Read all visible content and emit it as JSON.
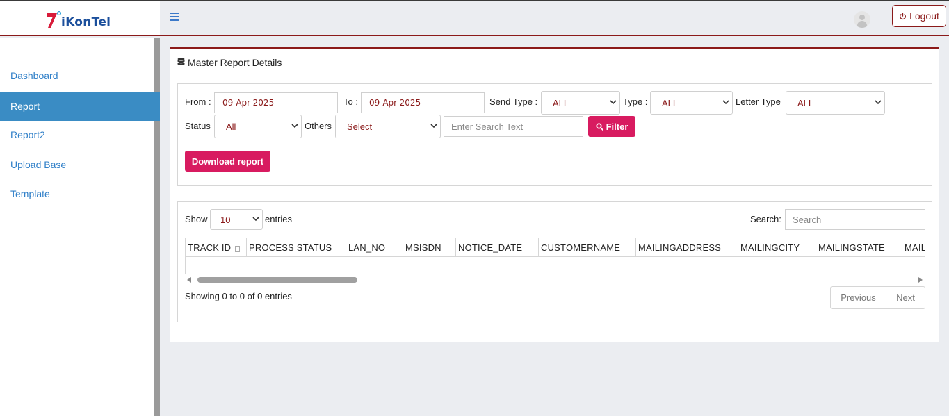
{
  "brand": {
    "logo_text": "iKonTel",
    "colors": {
      "red": "#d81b3a",
      "blue": "#1b4f9c"
    }
  },
  "header": {
    "menu_icon": "hamburger-icon",
    "avatar_icon": "user-avatar-icon",
    "logout_label": "Logout",
    "logout_icon": "power-icon"
  },
  "sidebar": {
    "items": [
      {
        "label": "Dashboard",
        "active": false
      },
      {
        "label": "Report",
        "active": true
      },
      {
        "label": "Report2",
        "active": false
      },
      {
        "label": "Upload Base",
        "active": false
      },
      {
        "label": "Template",
        "active": false
      }
    ]
  },
  "card": {
    "title": "Master Report Details",
    "title_icon": "database-icon"
  },
  "filters": {
    "from_label": "From :",
    "from_value": "09-Apr-2025",
    "to_label": "To :",
    "to_value": "09-Apr-2025",
    "send_type_label": "Send Type :",
    "send_type_value": "ALL",
    "type_label": "Type :",
    "type_value": "ALL",
    "letter_type_label": "Letter Type",
    "letter_type_value": "ALL",
    "status_label": "Status",
    "status_value": "All",
    "others_label": "Others",
    "others_value": "Select",
    "search_placeholder": "Enter Search Text",
    "filter_label": "Filter",
    "download_label": "Download report"
  },
  "table": {
    "show_label": "Show",
    "page_size": "10",
    "entries_label": "entries",
    "search_label": "Search:",
    "search_placeholder": "Search",
    "columns": [
      "TRACK ID",
      "PROCESS STATUS",
      "LAN_NO",
      "MSISDN",
      "NOTICE_DATE",
      "CUSTOMERNAME",
      "MAILINGADDRESS",
      "MAILINGCITY",
      "MAILINGSTATE",
      "MAIL"
    ],
    "info": "Showing 0 to 0 of 0 entries",
    "previous_label": "Previous",
    "next_label": "Next"
  }
}
